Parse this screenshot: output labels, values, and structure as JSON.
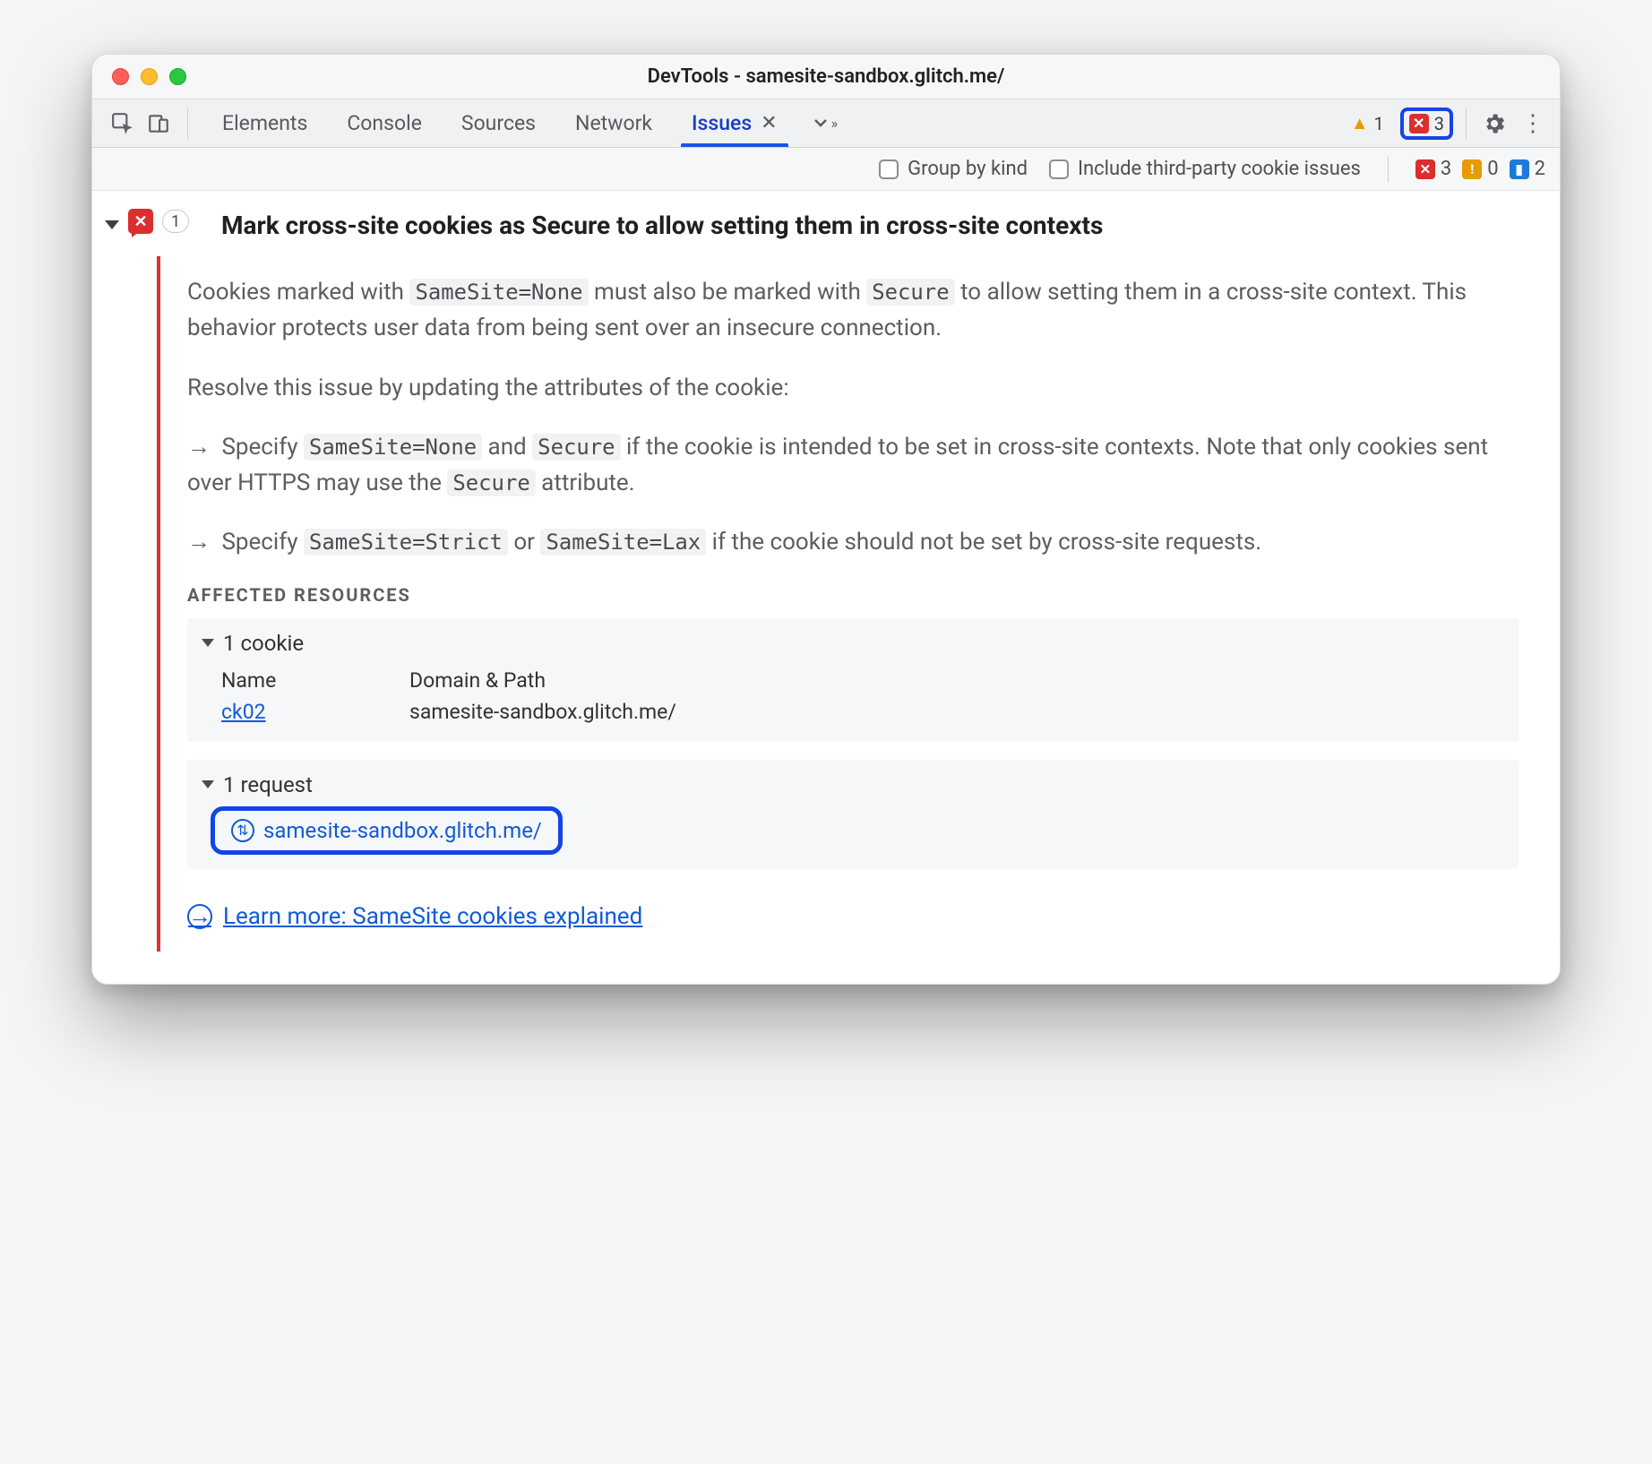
{
  "window": {
    "title": "DevTools - samesite-sandbox.glitch.me/"
  },
  "tabs": {
    "elements": "Elements",
    "console": "Console",
    "sources": "Sources",
    "network": "Network",
    "issues": "Issues"
  },
  "topCounts": {
    "warnings": "1",
    "errors": "3"
  },
  "filter": {
    "groupByKind": "Group by kind",
    "thirdParty": "Include third-party cookie issues",
    "counts": {
      "errors": "3",
      "warnings": "0",
      "info": "2"
    }
  },
  "issue": {
    "count": "1",
    "title": "Mark cross-site cookies as Secure to allow setting them in cross-site contexts",
    "para1_a": "Cookies marked with ",
    "code1": "SameSite=None",
    "para1_b": " must also be marked with ",
    "code2": "Secure",
    "para1_c": " to allow setting them in a cross-site context. This behavior protects user data from being sent over an insecure connection.",
    "para2": "Resolve this issue by updating the attributes of the cookie:",
    "bullet1_a": "Specify ",
    "bullet1_code1": "SameSite=None",
    "bullet1_b": " and ",
    "bullet1_code2": "Secure",
    "bullet1_c": " if the cookie is intended to be set in cross-site contexts. Note that only cookies sent over HTTPS may use the ",
    "bullet1_code3": "Secure",
    "bullet1_d": " attribute.",
    "bullet2_a": "Specify ",
    "bullet2_code1": "SameSite=Strict",
    "bullet2_b": " or ",
    "bullet2_code2": "SameSite=Lax",
    "bullet2_c": " if the cookie should not be set by cross-site requests.",
    "affectedLabel": "AFFECTED RESOURCES",
    "cookieHeader": "1 cookie",
    "cookieCols": {
      "name": "Name",
      "domain": "Domain & Path"
    },
    "cookieRow": {
      "name": "ck02",
      "domain": "samesite-sandbox.glitch.me/"
    },
    "requestHeader": "1 request",
    "requestUrl": "samesite-sandbox.glitch.me/",
    "learnMore": "Learn more: SameSite cookies explained"
  }
}
